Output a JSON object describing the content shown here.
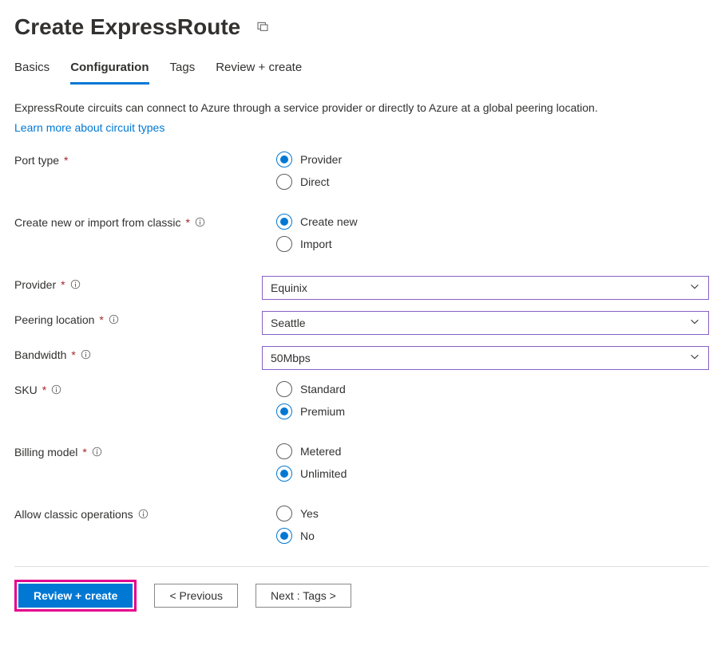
{
  "header": {
    "title": "Create ExpressRoute"
  },
  "tabs": {
    "basics": "Basics",
    "configuration": "Configuration",
    "tags": "Tags",
    "review": "Review + create"
  },
  "intro": {
    "text": "ExpressRoute circuits can connect to Azure through a service provider or directly to Azure at a global peering location.",
    "link": "Learn more about circuit types"
  },
  "fields": {
    "portType": {
      "label": "Port type",
      "options": {
        "provider": "Provider",
        "direct": "Direct"
      }
    },
    "createImport": {
      "label": "Create new or import from classic",
      "options": {
        "create": "Create new",
        "import": "Import"
      }
    },
    "provider": {
      "label": "Provider",
      "value": "Equinix"
    },
    "peering": {
      "label": "Peering location",
      "value": "Seattle"
    },
    "bandwidth": {
      "label": "Bandwidth",
      "value": "50Mbps"
    },
    "sku": {
      "label": "SKU",
      "options": {
        "standard": "Standard",
        "premium": "Premium"
      }
    },
    "billing": {
      "label": "Billing model",
      "options": {
        "metered": "Metered",
        "unlimited": "Unlimited"
      }
    },
    "classicOps": {
      "label": "Allow classic operations",
      "options": {
        "yes": "Yes",
        "no": "No"
      }
    }
  },
  "footer": {
    "review": "Review + create",
    "previous": "< Previous",
    "next": "Next : Tags >"
  }
}
